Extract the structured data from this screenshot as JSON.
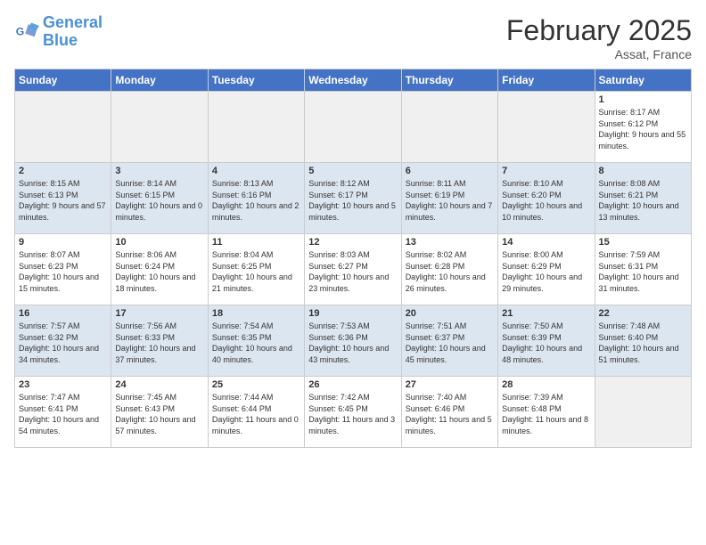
{
  "logo": {
    "line1": "General",
    "line2": "Blue"
  },
  "title": "February 2025",
  "location": "Assat, France",
  "days_of_week": [
    "Sunday",
    "Monday",
    "Tuesday",
    "Wednesday",
    "Thursday",
    "Friday",
    "Saturday"
  ],
  "weeks": [
    [
      {
        "num": "",
        "info": ""
      },
      {
        "num": "",
        "info": ""
      },
      {
        "num": "",
        "info": ""
      },
      {
        "num": "",
        "info": ""
      },
      {
        "num": "",
        "info": ""
      },
      {
        "num": "",
        "info": ""
      },
      {
        "num": "1",
        "info": "Sunrise: 8:17 AM\nSunset: 6:12 PM\nDaylight: 9 hours and 55 minutes."
      }
    ],
    [
      {
        "num": "2",
        "info": "Sunrise: 8:15 AM\nSunset: 6:13 PM\nDaylight: 9 hours and 57 minutes."
      },
      {
        "num": "3",
        "info": "Sunrise: 8:14 AM\nSunset: 6:15 PM\nDaylight: 10 hours and 0 minutes."
      },
      {
        "num": "4",
        "info": "Sunrise: 8:13 AM\nSunset: 6:16 PM\nDaylight: 10 hours and 2 minutes."
      },
      {
        "num": "5",
        "info": "Sunrise: 8:12 AM\nSunset: 6:17 PM\nDaylight: 10 hours and 5 minutes."
      },
      {
        "num": "6",
        "info": "Sunrise: 8:11 AM\nSunset: 6:19 PM\nDaylight: 10 hours and 7 minutes."
      },
      {
        "num": "7",
        "info": "Sunrise: 8:10 AM\nSunset: 6:20 PM\nDaylight: 10 hours and 10 minutes."
      },
      {
        "num": "8",
        "info": "Sunrise: 8:08 AM\nSunset: 6:21 PM\nDaylight: 10 hours and 13 minutes."
      }
    ],
    [
      {
        "num": "9",
        "info": "Sunrise: 8:07 AM\nSunset: 6:23 PM\nDaylight: 10 hours and 15 minutes."
      },
      {
        "num": "10",
        "info": "Sunrise: 8:06 AM\nSunset: 6:24 PM\nDaylight: 10 hours and 18 minutes."
      },
      {
        "num": "11",
        "info": "Sunrise: 8:04 AM\nSunset: 6:25 PM\nDaylight: 10 hours and 21 minutes."
      },
      {
        "num": "12",
        "info": "Sunrise: 8:03 AM\nSunset: 6:27 PM\nDaylight: 10 hours and 23 minutes."
      },
      {
        "num": "13",
        "info": "Sunrise: 8:02 AM\nSunset: 6:28 PM\nDaylight: 10 hours and 26 minutes."
      },
      {
        "num": "14",
        "info": "Sunrise: 8:00 AM\nSunset: 6:29 PM\nDaylight: 10 hours and 29 minutes."
      },
      {
        "num": "15",
        "info": "Sunrise: 7:59 AM\nSunset: 6:31 PM\nDaylight: 10 hours and 31 minutes."
      }
    ],
    [
      {
        "num": "16",
        "info": "Sunrise: 7:57 AM\nSunset: 6:32 PM\nDaylight: 10 hours and 34 minutes."
      },
      {
        "num": "17",
        "info": "Sunrise: 7:56 AM\nSunset: 6:33 PM\nDaylight: 10 hours and 37 minutes."
      },
      {
        "num": "18",
        "info": "Sunrise: 7:54 AM\nSunset: 6:35 PM\nDaylight: 10 hours and 40 minutes."
      },
      {
        "num": "19",
        "info": "Sunrise: 7:53 AM\nSunset: 6:36 PM\nDaylight: 10 hours and 43 minutes."
      },
      {
        "num": "20",
        "info": "Sunrise: 7:51 AM\nSunset: 6:37 PM\nDaylight: 10 hours and 45 minutes."
      },
      {
        "num": "21",
        "info": "Sunrise: 7:50 AM\nSunset: 6:39 PM\nDaylight: 10 hours and 48 minutes."
      },
      {
        "num": "22",
        "info": "Sunrise: 7:48 AM\nSunset: 6:40 PM\nDaylight: 10 hours and 51 minutes."
      }
    ],
    [
      {
        "num": "23",
        "info": "Sunrise: 7:47 AM\nSunset: 6:41 PM\nDaylight: 10 hours and 54 minutes."
      },
      {
        "num": "24",
        "info": "Sunrise: 7:45 AM\nSunset: 6:43 PM\nDaylight: 10 hours and 57 minutes."
      },
      {
        "num": "25",
        "info": "Sunrise: 7:44 AM\nSunset: 6:44 PM\nDaylight: 11 hours and 0 minutes."
      },
      {
        "num": "26",
        "info": "Sunrise: 7:42 AM\nSunset: 6:45 PM\nDaylight: 11 hours and 3 minutes."
      },
      {
        "num": "27",
        "info": "Sunrise: 7:40 AM\nSunset: 6:46 PM\nDaylight: 11 hours and 5 minutes."
      },
      {
        "num": "28",
        "info": "Sunrise: 7:39 AM\nSunset: 6:48 PM\nDaylight: 11 hours and 8 minutes."
      },
      {
        "num": "",
        "info": ""
      }
    ]
  ]
}
